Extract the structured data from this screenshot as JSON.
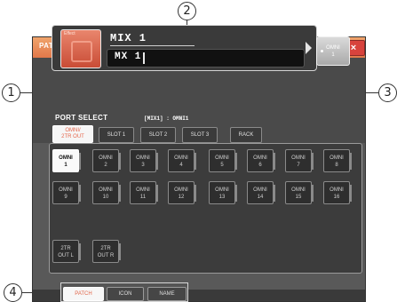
{
  "window": {
    "title": "PATCH / NAME",
    "close_label": "×"
  },
  "channel": {
    "icon_tag": "Effect",
    "name": "MIX 1",
    "name_field_value": "MX 1"
  },
  "patch": {
    "label": "PATCH",
    "button_line1": "OMNI",
    "button_line2": "1"
  },
  "port_select": {
    "label": "PORT SELECT",
    "current": "[MIX1] : OMNI1",
    "tabs": [
      {
        "line1": "OMNI/",
        "line2": "2TR OUT",
        "active": true
      },
      {
        "line1": "SLOT 1",
        "line2": "",
        "active": false
      },
      {
        "line1": "SLOT 2",
        "line2": "",
        "active": false
      },
      {
        "line1": "SLOT 3",
        "line2": "",
        "active": false
      },
      {
        "line1": "RACK",
        "line2": "",
        "active": false
      }
    ]
  },
  "ports": [
    {
      "line1": "OMNI",
      "line2": "1",
      "selected": true
    },
    {
      "line1": "OMNI",
      "line2": "2",
      "selected": false
    },
    {
      "line1": "OMNI",
      "line2": "3",
      "selected": false
    },
    {
      "line1": "OMNI",
      "line2": "4",
      "selected": false
    },
    {
      "line1": "OMNI",
      "line2": "5",
      "selected": false
    },
    {
      "line1": "OMNI",
      "line2": "6",
      "selected": false
    },
    {
      "line1": "OMNI",
      "line2": "7",
      "selected": false
    },
    {
      "line1": "OMNI",
      "line2": "8",
      "selected": false
    },
    {
      "line1": "OMNI",
      "line2": "9",
      "selected": false
    },
    {
      "line1": "OMNI",
      "line2": "10",
      "selected": false
    },
    {
      "line1": "OMNI",
      "line2": "11",
      "selected": false
    },
    {
      "line1": "OMNI",
      "line2": "12",
      "selected": false
    },
    {
      "line1": "OMNI",
      "line2": "13",
      "selected": false
    },
    {
      "line1": "OMNI",
      "line2": "14",
      "selected": false
    },
    {
      "line1": "OMNI",
      "line2": "15",
      "selected": false
    },
    {
      "line1": "OMNI",
      "line2": "16",
      "selected": false
    },
    {
      "line1": "2TR",
      "line2": "OUT L",
      "selected": false
    },
    {
      "line1": "2TR",
      "line2": "OUT R",
      "selected": false
    }
  ],
  "bottom_tabs": [
    {
      "label": "PATCH",
      "active": true
    },
    {
      "label": "ICON",
      "active": false
    },
    {
      "label": "NAME",
      "active": false
    }
  ],
  "callouts": [
    "1",
    "2",
    "3",
    "4"
  ],
  "colors": {
    "accent": "#e5664c",
    "titlebar": "#e98d5a",
    "close": "#d8433d",
    "panel": "#3c3c3c"
  }
}
